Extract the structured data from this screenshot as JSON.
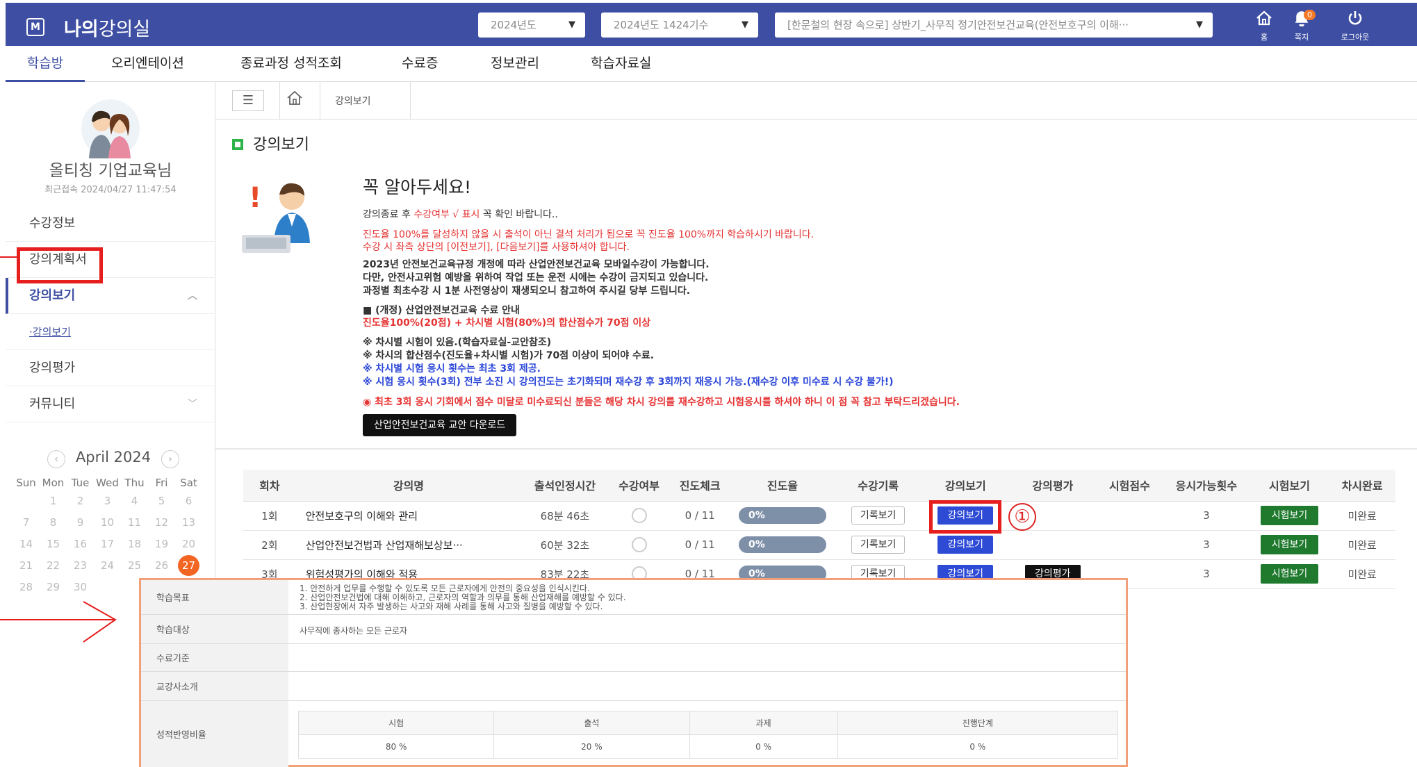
{
  "header": {
    "logo": "M",
    "title_bold": "나의",
    "title_rest": "강의실",
    "year_select": "2024년도",
    "term_select": "2024년도 1424기수",
    "course_select": "[한문철의 현장 속으로] 상반기_사무직 정기안전보건교육(안전보호구의 이해···",
    "icons": [
      {
        "name": "home-icon",
        "label": "홈"
      },
      {
        "name": "bell-icon",
        "label": "쪽지",
        "count": "0"
      },
      {
        "name": "power-icon",
        "label": "로그아웃"
      }
    ]
  },
  "menu": [
    "학습방",
    "오리엔테이션",
    "종료과정 성적조회",
    "수료증",
    "정보관리",
    "학습자료실"
  ],
  "sidebar": {
    "user_name": "올티칭 기업교육님",
    "last_login": "최근접속 2024/04/27 11:47:54",
    "items": [
      {
        "label": "수강정보"
      },
      {
        "label": "강의계획서"
      },
      {
        "label": "강의보기"
      },
      {
        "label": "·강의보기"
      },
      {
        "label": "강의평가"
      },
      {
        "label": "커뮤니티"
      }
    ]
  },
  "calendar": {
    "month": "April 2024",
    "weekdays": [
      "Sun",
      "Mon",
      "Tue",
      "Wed",
      "Thu",
      "Fri",
      "Sat"
    ],
    "today": "27"
  },
  "breadcrumb": {
    "current": "강의보기"
  },
  "page_title": "강의보기",
  "notice": {
    "heading": "꼭 알아두세요!",
    "line1_a": "강의종료 후 ",
    "line1_b": "수강여부 √ 표시",
    "line1_c": " 꼭 확인 바랍니다..",
    "line2": "진도율 100%를 달성하지 않을 시 출석이 아닌 결석 처리가 됨으로 꼭 진도율 100%까지 학습하시기 바랍니다.",
    "line3": "수강 시 좌측 상단의 [이전보기], [다음보기]를 사용하셔야 합니다.",
    "line4": "2023년 안전보건교육규정 개정에 따라 산업안전보건교육 모바일수강이 가능합니다.",
    "line5": "다만, 안전사고위험 예방을 위하여 작업 또는 운전 시에는 수강이 금지되고 있습니다.",
    "line6": "과정별 최초수강 시 1분 사전영상이 재생되오니 참고하여 주시길 당부 드립니다.",
    "line7": "■ (개정) 산업안전보건교육 수료 안내",
    "line8": "진도율100%(20점) + 차시별 시험(80%)의 합산점수가 70점 이상",
    "line9": "※ 차시별 시험이 있음.(학습자료실-교안참조)",
    "line10": "※ 차시의 합산점수(진도율+차시별 시험)가 70점 이상이 되어야 수료.",
    "line11": "※ 차시별 시험 응시 횟수는 최초 3회 제공.",
    "line12": "※ 시험 응시 횟수(3회) 전부 소진 시 강의진도는 초기화되며 재수강 후 3회까지 재응시 가능.(재수강 이후 미수료 시 수강 불가!)",
    "line13": "◉ 최초 3회 응시 기회에서 점수 미달로 미수료되신 분들은 해당 차시 강의를 재수강하고 시험응시를 하셔야 하니 이 점 꼭 참고 부탁드리겠습니다.",
    "download_btn": "산업안전보건교육 교안 다운로드"
  },
  "table": {
    "headers": [
      "회차",
      "강의명",
      "출석인정시간",
      "수강여부",
      "진도체크",
      "진도율",
      "수강기록",
      "강의보기",
      "강의평가",
      "시험점수",
      "응시가능횟수",
      "시험보기",
      "차시완료"
    ],
    "rows": [
      {
        "no": "1회",
        "title": "안전보호구의 이해와 관리",
        "time": "68분 46초",
        "check": "0 / 11",
        "progress": "0%",
        "record": "기록보기",
        "view": "강의보기",
        "eval": "",
        "score": "",
        "attempts": "3",
        "exam": "시험보기",
        "done": "미완료"
      },
      {
        "no": "2회",
        "title": "산업안전보건법과 산업재해보상보···",
        "time": "60분 32초",
        "check": "0 / 11",
        "progress": "0%",
        "record": "기록보기",
        "view": "강의보기",
        "eval": "",
        "score": "",
        "attempts": "3",
        "exam": "시험보기",
        "done": "미완료"
      },
      {
        "no": "3회",
        "title": "위험성평가의 이해와 적용",
        "time": "83분 22초",
        "check": "0 / 11",
        "progress": "0%",
        "record": "기록보기",
        "view": "강의보기",
        "eval": "강의평가",
        "score": "",
        "attempts": "3",
        "exam": "시험보기",
        "done": "미완료"
      }
    ]
  },
  "annotation": {
    "marker": "①"
  },
  "popup": {
    "labels": [
      "학습목표",
      "학습대상",
      "수료기준",
      "교강사소개",
      "성적반영비율"
    ],
    "goals": [
      "1. 안전하게 업무를 수행할 수 있도록 모든 근로자에게 안전의 중요성을 인식시킨다.",
      "2. 산업안전보건법에 대해 이해하고, 근로자의 역할과 의무를 통해 산업재해를 예방할 수 있다.",
      "3. 산업현장에서 자주 발생하는 사고와 재해 사례를 통해 사고와 질병을 예방할 수 있다."
    ],
    "target": "사무직에 종사하는 모든 근로자",
    "ratio_headers": [
      "시험",
      "출석",
      "과제",
      "진행단계"
    ],
    "ratio_values": [
      "80 %",
      "20 %",
      "0 %",
      "0 %"
    ]
  },
  "colors": {
    "brand": "#3e4fa3",
    "accent_red": "#e61e1e",
    "green": "#1f7a2e",
    "blue_btn": "#2e4bd6",
    "today": "#f26522"
  }
}
